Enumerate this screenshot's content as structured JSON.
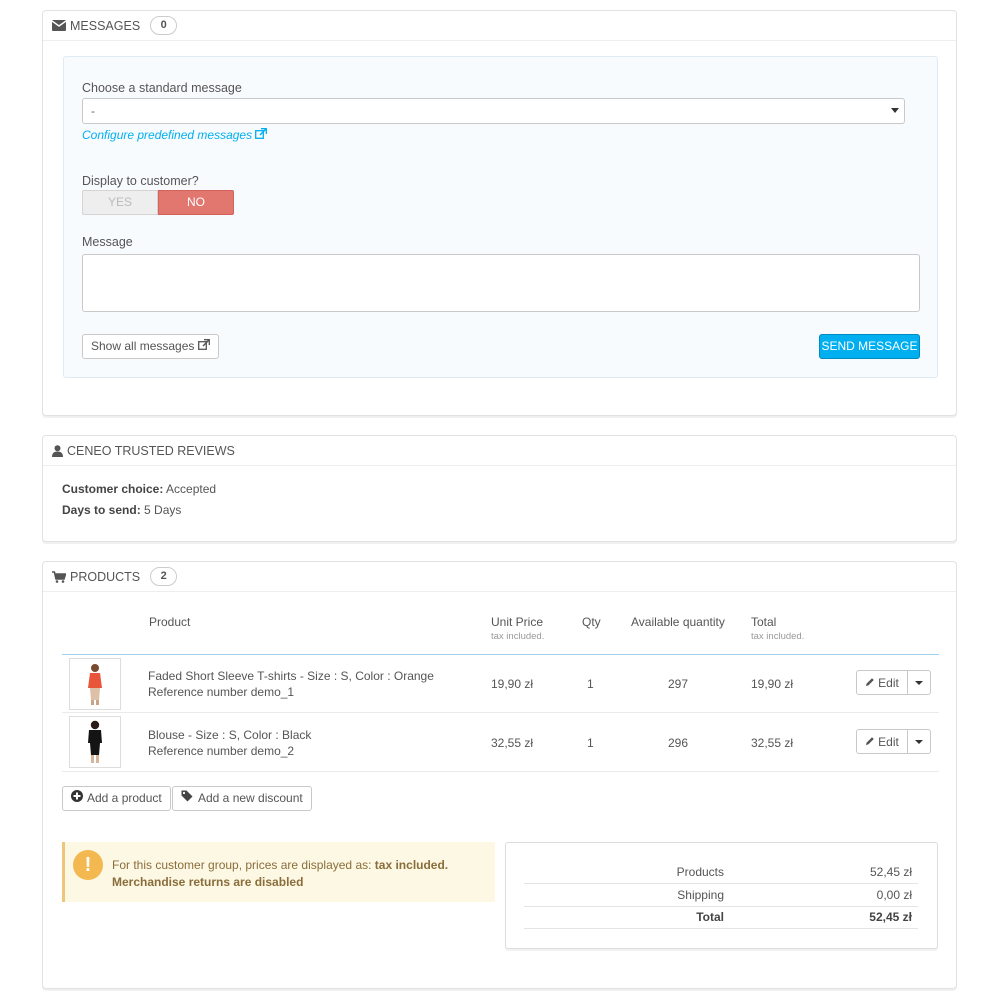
{
  "messages": {
    "title": "Messages",
    "count": "0",
    "choose_label": "Choose a standard message",
    "select_value": "-",
    "configure_link": "Configure predefined messages",
    "display_label": "Display to customer?",
    "toggle_yes": "YES",
    "toggle_no": "NO",
    "toggle_selected": "NO",
    "message_label": "Message",
    "message_value": "",
    "show_all_button": "Show all messages",
    "send_button": "SEND MESSAGE",
    "accent_color": "#00aff0",
    "no_color": "#e1776f"
  },
  "ceneo": {
    "title": "Ceneo Trusted Reviews",
    "choice_key": "Customer choice:",
    "choice_value": "Accepted",
    "days_key": "Days to send:",
    "days_value": "5 Days"
  },
  "products": {
    "title": "Products",
    "count": "2",
    "columns": {
      "product": "Product",
      "unit_price": "Unit Price",
      "unit_price_note": "tax included.",
      "qty": "Qty",
      "available": "Available quantity",
      "total": "Total",
      "total_note": "tax included."
    },
    "rows": [
      {
        "name": "Faded Short Sleeve T-shirts - Size : S, Color : Orange",
        "reference": "Reference number demo_1",
        "unit_price": "19,90 zł",
        "qty": "1",
        "available": "297",
        "total": "19,90 zł",
        "edit_label": "Edit"
      },
      {
        "name": "Blouse - Size : S, Color : Black",
        "reference": "Reference number demo_2",
        "unit_price": "32,55 zł",
        "qty": "1",
        "available": "296",
        "total": "32,55 zł",
        "edit_label": "Edit"
      }
    ],
    "add_product_button": "Add a product",
    "add_discount_button": "Add a new discount",
    "alert_text": "For this customer group, prices are displayed as:",
    "alert_bold": "tax included.",
    "alert_line2": "Merchandise returns are disabled",
    "totals": [
      {
        "label": "Products",
        "value": "52,45 zł"
      },
      {
        "label": "Shipping",
        "value": "0,00 zł"
      },
      {
        "label": "Total",
        "value": "52,45 zł"
      }
    ]
  }
}
